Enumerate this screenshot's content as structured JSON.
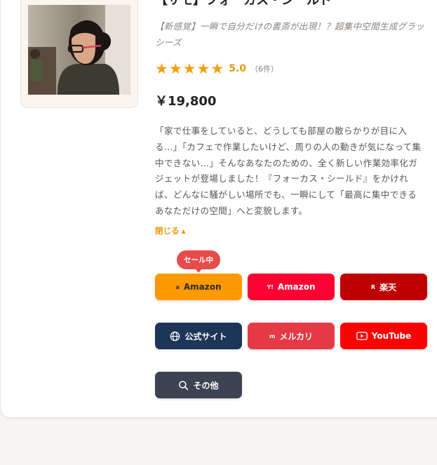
{
  "product": {
    "title": "【サモ】フォーカス・シールド",
    "tagline": "【新感覚】一瞬で自分だけの書斎が出現！？超集中空間生成グラッシーズ",
    "rating": {
      "stars": 5,
      "score": "5.0",
      "count": "（6件）"
    },
    "price": "￥19,800",
    "description": "「家で仕事をしていると、どうしても部屋の散らかりが目に入る…」「カフェで作業したいけど、周りの人の動きが気になって集中できない…」そんなあなたのための、全く新しい作業効率化ガジェットが登場しました！『フォーカス・シールド』をかければ、どんなに騒がしい場所でも、一瞬にして「最高に集中できるあなただけの空間」へと変貌します。",
    "toggle_label": "閉じる",
    "toggle_icon": "chevron-up-icon"
  },
  "sale_badge": "セール中",
  "buttons": {
    "amazon": {
      "label": "Amazon",
      "icon_text": "a",
      "color": "#ff9900"
    },
    "yahoo": {
      "label": "Amazon",
      "icon_text": "Y!",
      "color": "#ff0033"
    },
    "rakuten": {
      "label": "楽天",
      "icon_text": "R",
      "color": "#bf0000"
    },
    "official": {
      "label": "公式サイト",
      "icon": "globe-icon",
      "color": "#1d3557"
    },
    "mercari": {
      "label": "メルカリ",
      "icon_text": "m",
      "color": "#e63946"
    },
    "youtube": {
      "label": "YouTube",
      "icon": "youtube-icon",
      "color": "#ff0000"
    },
    "other": {
      "label": "その他",
      "icon": "search-icon",
      "color": "#3d4352"
    }
  },
  "colors": {
    "accent": "#e89a0e",
    "star": "#f0a010"
  }
}
